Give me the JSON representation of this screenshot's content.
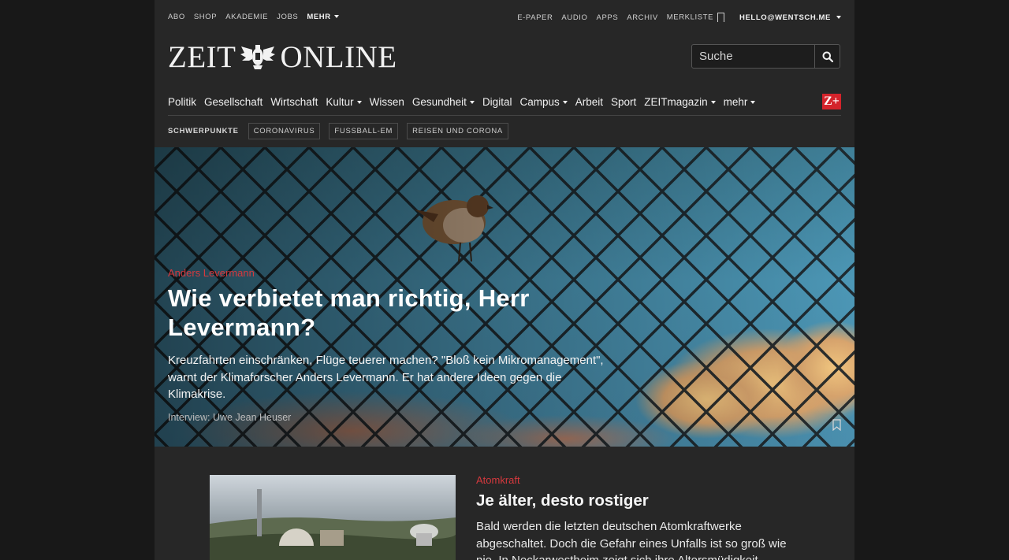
{
  "topbar": {
    "left": [
      {
        "label": "ABO"
      },
      {
        "label": "SHOP"
      },
      {
        "label": "AKADEMIE"
      },
      {
        "label": "JOBS"
      },
      {
        "label": "MEHR"
      }
    ],
    "right": [
      {
        "label": "E-PAPER"
      },
      {
        "label": "AUDIO"
      },
      {
        "label": "APPS"
      },
      {
        "label": "ARCHIV"
      },
      {
        "label": "MERKLISTE"
      }
    ],
    "account": "HELLO@WENTSCH.ME"
  },
  "logo": {
    "left": "ZEIT",
    "right": "ONLINE"
  },
  "search": {
    "placeholder": "Suche",
    "icon": "search-icon"
  },
  "nav": {
    "items": [
      {
        "label": "Politik"
      },
      {
        "label": "Gesellschaft"
      },
      {
        "label": "Wirtschaft"
      },
      {
        "label": "Kultur"
      },
      {
        "label": "Wissen"
      },
      {
        "label": "Gesundheit"
      },
      {
        "label": "Digital"
      },
      {
        "label": "Campus"
      },
      {
        "label": "Arbeit"
      },
      {
        "label": "Sport"
      },
      {
        "label": "ZEITmagazin"
      },
      {
        "label": "mehr"
      }
    ],
    "zplus": "Z+"
  },
  "topics": {
    "label": "SCHWERPUNKTE",
    "tags": [
      "CORONAVIRUS",
      "FUSSBALL-EM",
      "REISEN UND CORONA"
    ]
  },
  "hero": {
    "kicker": "Anders Levermann",
    "title": "Wie verbietet man richtig, Herr Levermann?",
    "teaser": "Kreuzfahrten einschränken, Flüge teuerer machen? \"Bloß kein Mikromanagement\", warnt der Klimaforscher Anders Levermann. Er hat andere Ideen gegen die Klimakrise.",
    "byline": "Interview: Uwe Jean Heuser"
  },
  "article2": {
    "kicker": "Atomkraft",
    "title": "Je älter, desto rostiger",
    "teaser": "Bald werden die letzten deutschen Atomkraftwerke abgeschaltet. Doch die Gefahr eines Unfalls ist so groß wie nie. In Neckarwestheim zeigt sich ihre Altersmüdigkeit."
  },
  "colors": {
    "accent": "#d5393e",
    "zplus": "#d4232b",
    "background": "#272727"
  }
}
